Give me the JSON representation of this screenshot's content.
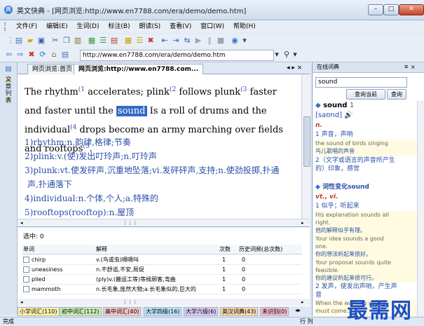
{
  "window": {
    "title": "英文快典 - [网页浏览:http://www.en7788.com/era/demo/demo.htm]",
    "minimize": "–",
    "maximize": "□",
    "close": "✕"
  },
  "menu": [
    "文件(F)",
    "编辑(E)",
    "生词(D)",
    "标注(B)",
    "朗读(S)",
    "查看(V)",
    "窗口(W)",
    "帮助(H)"
  ],
  "address": {
    "url": "http://www.en7788.com/era/demo/demo.htm"
  },
  "sidebar": {
    "vertical_label": "文章列表"
  },
  "tabs": [
    {
      "label": "网页浏览:首页",
      "active": false
    },
    {
      "label": "网页浏览:http://www.en7788.com...",
      "active": true
    }
  ],
  "tab_nav": "◂ ▸ ×",
  "article": {
    "para_parts": [
      "The rhythm",
      "(1",
      " accelerates; plink",
      "(2",
      " follows plunk",
      "(3",
      " faster and faster until the ",
      "sound",
      " Is a roll of drums and the individual",
      "(4",
      " drops become an army marching over fields and rooftops",
      "(5",
      "."
    ],
    "notes": [
      "1)rhythm:n.韵律,格律;节奏",
      "2)plink:v.(使)发出叮玲声;n.叮玲声",
      "3)plunk:vt.使发砰声,沉重地坠落;vi.发砰砰声,支持;n.使劲投掷,扑通",
      "声,扑通落下",
      "4)individual:n.个体,个人;a.特殊的",
      "5)rooftops(rooftop):n.屋顶"
    ]
  },
  "vocab": {
    "selected_count": "选中: 0",
    "columns": [
      "单词",
      "解释",
      "次数",
      "历史词频(总次数)"
    ],
    "rows": [
      {
        "word": "chirp",
        "definition": "v.(鸟或虫)啁啁叫",
        "times": "1",
        "history": "0"
      },
      {
        "word": "uneasiness",
        "definition": "n.不舒适,不安,局促",
        "times": "1",
        "history": "0"
      },
      {
        "word": "plied",
        "definition": "(ply)v.(搬运工等)等候顾客,弯曲",
        "times": "1",
        "history": "0"
      },
      {
        "word": "mammoth",
        "definition": "n.长毛象,庞然大物;a.长毛象似的,巨大的",
        "times": "1",
        "history": "0"
      }
    ]
  },
  "categories": [
    {
      "label": "小学词汇(110)",
      "color": "#fff2a6"
    },
    {
      "label": "初中词汇(112)",
      "color": "#c9ecb3"
    },
    {
      "label": "高中词汇(40)",
      "color": "#f6c6c6"
    },
    {
      "label": "大学四级(16)",
      "color": "#b9e3f7"
    },
    {
      "label": "大学六级(6)",
      "color": "#d9c8ef"
    },
    {
      "label": "英汉词典(43)",
      "color": "#f7d6a9"
    },
    {
      "label": "未识别(0)",
      "color": "#f1b9c9"
    }
  ],
  "status": {
    "left": "完成",
    "right": "行 列"
  },
  "dictionary": {
    "header": "在线词典",
    "header_pin": "ㅍ ×",
    "search_value": "sound",
    "btn_current": "查询当前",
    "btn_query": "查询",
    "word": "sound",
    "word_num": "1",
    "phonetic": "[saʊnd]",
    "pos1": "n.",
    "def1": "1 声音，声响",
    "ex1_en": "the sound of birds singing",
    "ex1_cn": "鸟儿歌唱的声音",
    "def2": "2（文字或语言的声音所产生",
    "def2b": "的）印象，感觉",
    "section2": "词性变化sound",
    "pos2": "vt., vi.",
    "def3": "1 似乎；听起来",
    "ex3_en1": "His explanation sounds all",
    "ex3_en2": "right.",
    "ex3_cn": "他的解释似乎有理。",
    "ex4_en1": "Your idea sounds a good",
    "ex4_en2": "one.",
    "ex4_cn": "你的想法听起来很好。",
    "ex5_en1": "Your proposal sounds quite",
    "ex5_en2": "feasible.",
    "ex5_cn": "你的建议听起来很可行。",
    "def4": "2 发声，使发出声响，产生声",
    "def4b": "音",
    "ex6_en1": "When the warning sound",
    "ex6_en2": "must come..."
  },
  "watermark": "最需网"
}
